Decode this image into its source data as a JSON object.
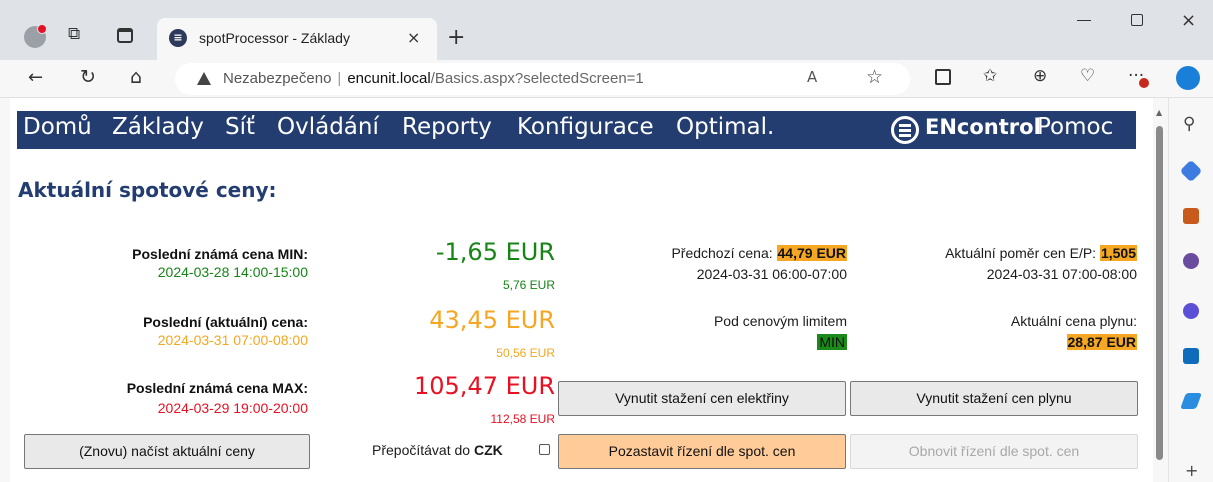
{
  "browser": {
    "tab_title": "spotProcessor - Základy",
    "tab_close": "×",
    "new_tab": "+",
    "window_close": "×",
    "url_insecure_label": "Nezabezpečeno",
    "url_separator": "|",
    "url_host": "encunit.local",
    "url_path": "/Basics.aspx?selectedScreen=1",
    "back_icon": "←",
    "refresh_icon": "↻",
    "home_icon": "⌂",
    "read_aloud_icon": "A",
    "favorite_icon": "☆",
    "more_icon": "···"
  },
  "nav": {
    "items": [
      "Domů",
      "Základy",
      "Síť",
      "Ovládání",
      "Reporty",
      "Konfigurace",
      "Optimal."
    ],
    "logo_text": "ENcontrol",
    "help": "Pomoc"
  },
  "heading": "Aktuální spotové ceny:",
  "prices": {
    "min": {
      "label": "Poslední známá cena MIN:",
      "time": "2024-03-28 14:00-15:00",
      "value": "-1,65 EUR",
      "sub": "5,76 EUR",
      "color": "#168516"
    },
    "current": {
      "label": "Poslední (aktuální) cena:",
      "time": "2024-03-31 07:00-08:00",
      "value": "43,45 EUR",
      "sub": "50,56 EUR",
      "color": "#f5a623"
    },
    "max": {
      "label": "Poslední známá cena MAX:",
      "time": "2024-03-29 19:00-20:00",
      "value": "105,47 EUR",
      "sub": "112,58 EUR",
      "color": "#e81123"
    }
  },
  "previous": {
    "label": "Předchozí cena:",
    "value": "44,79 EUR",
    "time": "2024-03-31 06:00-07:00"
  },
  "ratio": {
    "label": "Aktuální poměr cen E/P:",
    "value": "1,505",
    "time": "2024-03-31 07:00-08:00"
  },
  "limit": {
    "label": "Pod cenovým limitem",
    "badge": "MIN"
  },
  "gas": {
    "label": "Aktuální cena plynu:",
    "value": "28,87 EUR"
  },
  "buttons": {
    "reload": "(Znovu) načíst aktuální ceny",
    "force_electricity": "Vynutit stažení cen elektřiny",
    "force_gas": "Vynutit stažení cen plynu",
    "pause": "Pozastavit řízení dle spot. cen",
    "resume": "Obnovit řízení dle spot. cen"
  },
  "czk": {
    "label": "Přepočítávat do ",
    "currency": "CZK",
    "checked": false
  },
  "colors": {
    "navbar": "#233d70",
    "highlight": "#f5a623",
    "badge_green": "#1a8a1a",
    "button_orange": "#ffcc99"
  }
}
